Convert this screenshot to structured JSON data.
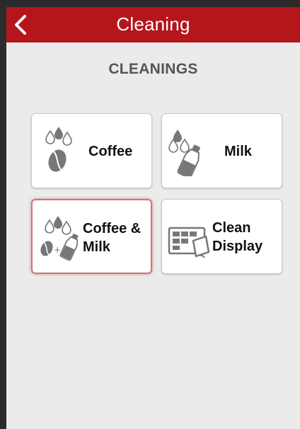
{
  "header": {
    "title": "Cleaning",
    "back_icon": "chevron-left-icon",
    "background_color": "#b4161b"
  },
  "section": {
    "title": "CLEANINGS"
  },
  "tiles": [
    {
      "label": "Coffee",
      "icon": "coffee-bean-drops-icon",
      "selected": false
    },
    {
      "label": "Milk",
      "icon": "milk-bottle-drops-icon",
      "selected": false
    },
    {
      "label": "Coffee &\nMilk",
      "icon": "coffee-milk-drops-icon",
      "selected": true
    },
    {
      "label": "Clean\nDisplay",
      "icon": "display-wipe-icon",
      "selected": false
    }
  ],
  "colors": {
    "accent": "#b4161b",
    "background": "#ebebeb",
    "tile": "#ffffff",
    "icon": "#777777"
  }
}
